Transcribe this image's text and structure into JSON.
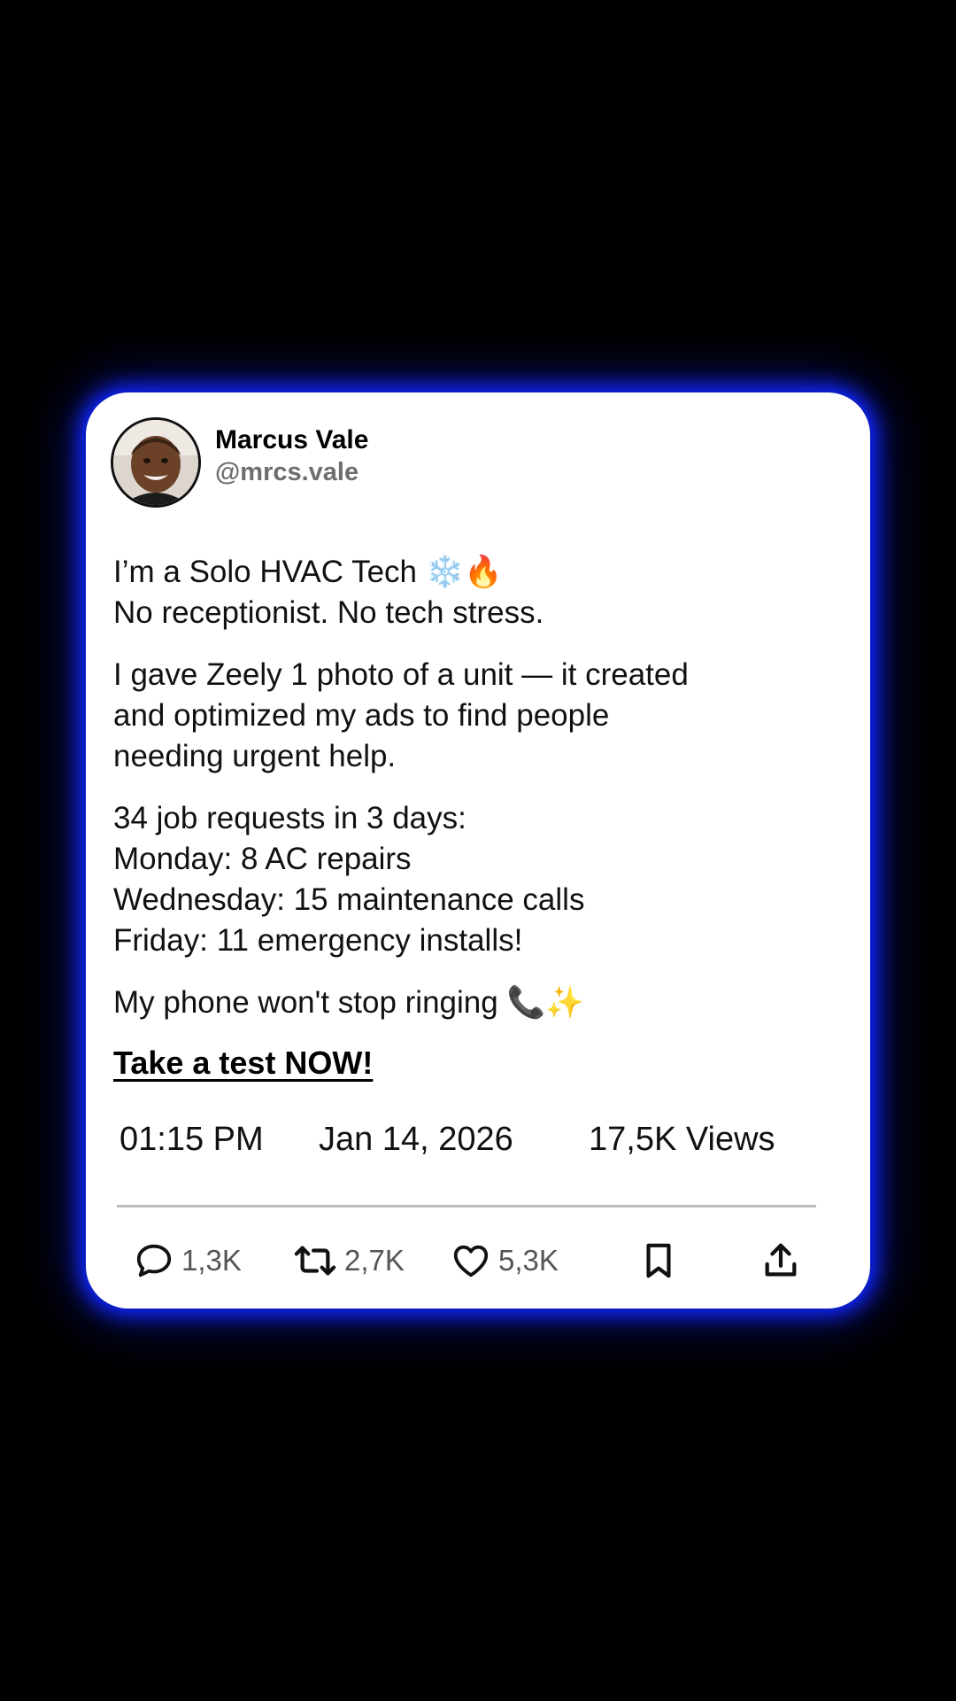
{
  "author": {
    "name": "Marcus Vale",
    "handle": "@mrcs.vale"
  },
  "post": {
    "paragraphs": [
      [
        "I’m a Solo HVAC Tech ❄️🔥",
        "No receptionist. No tech stress."
      ],
      [
        "I gave Zeely 1 photo of a unit — it created",
        "and optimized my ads to find people",
        "needing urgent help."
      ],
      [
        "34 job requests in 3 days:",
        "Monday: 8 AC repairs",
        "Wednesday: 15 maintenance calls",
        "Friday: 11 emergency installs!"
      ],
      [
        "My phone won't stop ringing 📞✨"
      ]
    ],
    "cta": "Take a test NOW!"
  },
  "meta": {
    "time": "01:15   PM",
    "date": "Jan   14, 2026",
    "views": "17,5K Views"
  },
  "actions": {
    "replies": "1,3K",
    "reposts": "2,7K",
    "likes": "5,3K"
  },
  "colors": {
    "card_glow": "#1225ff",
    "background": "#000000"
  }
}
